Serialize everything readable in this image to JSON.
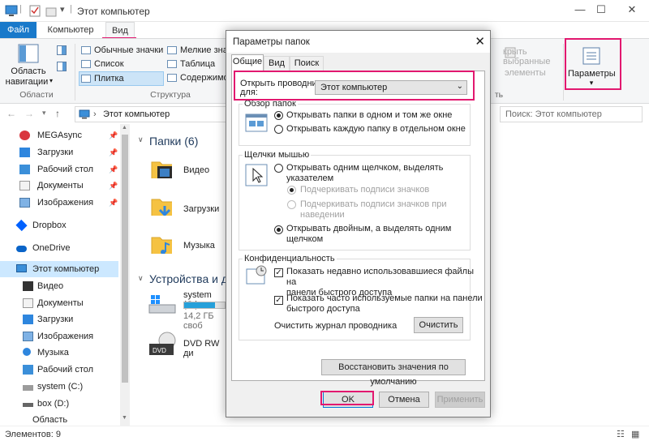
{
  "window": {
    "title": "Этот компьютер",
    "controls": [
      "—",
      "☐",
      "✕"
    ]
  },
  "ribbon": {
    "tabs": {
      "file": "Файл",
      "computer": "Компьютер",
      "view": "Вид"
    },
    "nav_pane_label_1": "Область",
    "nav_pane_label_2": "навигации",
    "group_areas": "Области",
    "layout": {
      "large_icons_label": "Обычные значки",
      "list_label": "Список",
      "tiles_label": "Плитка",
      "small_icons_label": "Мелкие зна",
      "table_label": "Таблица",
      "content_label": "Содержимо"
    },
    "group_structure": "Структура",
    "hide_selected_1": "крыть выбранные",
    "hide_selected_2": "элементы",
    "group_show": "ть",
    "options_label": "Параметры",
    "options_arrow": "▾"
  },
  "address": {
    "path": "Этот компьютер",
    "search_placeholder": "Поиск: Этот компьютер"
  },
  "nav": {
    "items": [
      {
        "label": "MEGAsync",
        "pinned": true
      },
      {
        "label": "Загрузки",
        "pinned": true
      },
      {
        "label": "Рабочий стол",
        "pinned": true
      },
      {
        "label": "Документы",
        "pinned": true
      },
      {
        "label": "Изображения",
        "pinned": true
      },
      {
        "label": "Dropbox"
      },
      {
        "label": "OneDrive"
      },
      {
        "label": "Этот компьютер"
      },
      {
        "label": "Видео"
      },
      {
        "label": "Документы"
      },
      {
        "label": "Загрузки"
      },
      {
        "label": "Изображения"
      },
      {
        "label": "Музыка"
      },
      {
        "label": "Рабочий стол"
      },
      {
        "label": "system (C:)"
      },
      {
        "label": "box (D:)"
      },
      {
        "label": "Область"
      }
    ]
  },
  "content": {
    "folders_header": "Папки (6)",
    "folders": [
      "Видео",
      "Загрузки",
      "Музыка"
    ],
    "devices_header": "Устройства и ди",
    "drive_c_label": "system (C:)",
    "drive_c_free": "14,2 ГБ своб",
    "drive_c_fill": 0.75,
    "dvd_label": "DVD RW ди",
    "dvd_icon_text": "DVD"
  },
  "status": {
    "items_count": "Элементов: 9"
  },
  "dialog": {
    "title": "Параметры папок",
    "tabs": [
      "Общие",
      "Вид",
      "Поиск"
    ],
    "open_explorer_label_1": "Открыть проводник",
    "open_explorer_label_2": "для:",
    "open_explorer_value": "Этот компьютер",
    "browse_group": "Обзор папок",
    "browse_same": "Открывать папки в одном и том же окне",
    "browse_new": "Открывать каждую папку в отдельном окне",
    "click_group": "Щелчки мышью",
    "single_click_1": "Открывать одним щелчком, выделять",
    "single_click_2": "указателем",
    "underline_icons": "Подчеркивать подписи значков",
    "underline_hover_1": "Подчеркивать подписи значков при",
    "underline_hover_2": "наведении",
    "double_click_1": "Открывать двойным, а выделять одним",
    "double_click_2": "щелчком",
    "privacy_group": "Конфиденциальность",
    "recent_files_1": "Показать недавно использовавшиеся файлы на",
    "recent_files_2": "панели быстрого доступа",
    "frequent_folders_1": "Показать часто используемые папки на панели",
    "frequent_folders_2": "быстрого доступа",
    "clear_history_label": "Очистить журнал проводника",
    "clear_button": "Очистить",
    "restore_defaults": "Восстановить значения по умолчанию",
    "ok": "OK",
    "cancel": "Отмена",
    "apply": "Применить"
  },
  "colors": {
    "accent": "#1979ca",
    "highlight": "#e2186f",
    "selection": "#cce8ff"
  }
}
